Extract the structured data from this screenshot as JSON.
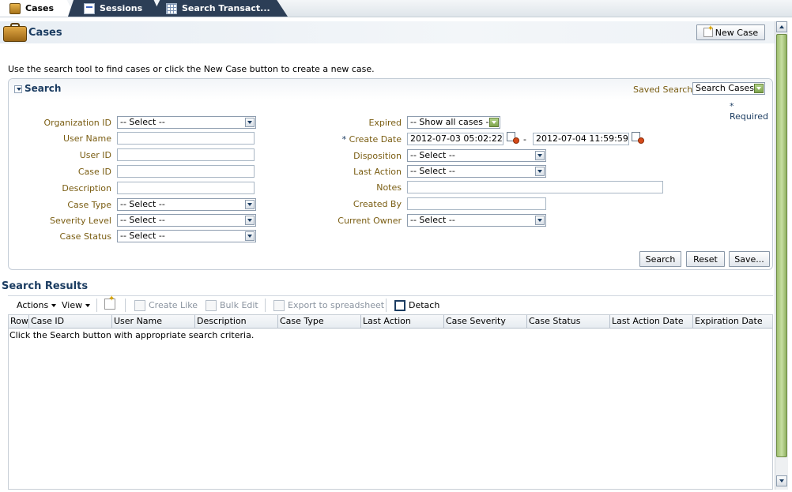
{
  "tabs": [
    {
      "label": "Cases",
      "icon": "briefcase-icon",
      "active": true
    },
    {
      "label": "Sessions",
      "icon": "sessions-icon",
      "active": false
    },
    {
      "label": "Search Transact...",
      "icon": "grid-icon",
      "active": false
    }
  ],
  "header": {
    "title": "Cases",
    "new_case_label": "New Case"
  },
  "instruction": "Use the search tool to find cases or click the New Case button to create a new case.",
  "search": {
    "title": "Search",
    "saved_search_label": "Saved Search",
    "saved_search_value": "Search Cases",
    "required_note": "Required",
    "required_star": "*",
    "fields_left": {
      "organization_id": {
        "label": "Organization ID",
        "value": "-- Select --"
      },
      "user_name": {
        "label": "User Name",
        "value": ""
      },
      "user_id": {
        "label": "User ID",
        "value": ""
      },
      "case_id": {
        "label": "Case ID",
        "value": ""
      },
      "description": {
        "label": "Description",
        "value": ""
      },
      "case_type": {
        "label": "Case Type",
        "value": "-- Select --"
      },
      "severity_level": {
        "label": "Severity Level",
        "value": "-- Select --"
      },
      "case_status": {
        "label": "Case Status",
        "value": "-- Select --"
      }
    },
    "fields_right": {
      "expired": {
        "label": "Expired",
        "value": "-- Show all cases --"
      },
      "create_date": {
        "label": "Create Date",
        "from": "2012-07-03 05:02:22 AM",
        "to": "2012-07-04 11:59:59 PM",
        "separator": "-"
      },
      "disposition": {
        "label": "Disposition",
        "value": "-- Select --"
      },
      "last_action": {
        "label": "Last Action",
        "value": "-- Select --"
      },
      "notes": {
        "label": "Notes",
        "value": ""
      },
      "created_by": {
        "label": "Created By",
        "value": ""
      },
      "current_owner": {
        "label": "Current Owner",
        "value": "-- Select --"
      }
    },
    "buttons": {
      "search": "Search",
      "reset": "Reset",
      "save": "Save..."
    }
  },
  "results": {
    "title": "Search Results",
    "toolbar": {
      "actions": "Actions",
      "view": "View",
      "create_like": "Create Like",
      "bulk_edit": "Bulk Edit",
      "export": "Export to spreadsheet",
      "detach": "Detach"
    },
    "columns": [
      "Row",
      "Case ID",
      "User Name",
      "Description",
      "Case Type",
      "Last Action",
      "Case Severity",
      "Case Status",
      "Last Action Date",
      "Expiration Date"
    ],
    "empty_message": "Click the Search button with appropriate search criteria."
  }
}
